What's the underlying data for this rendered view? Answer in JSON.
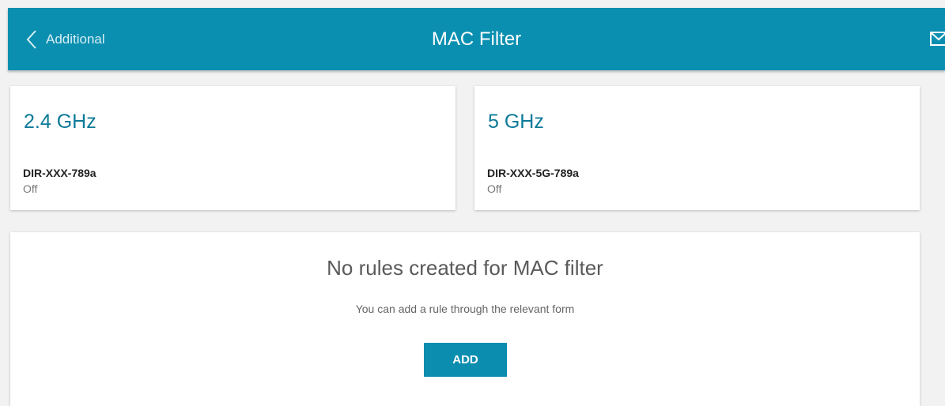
{
  "header": {
    "back_label": "Additional",
    "title": "MAC Filter",
    "back_icon": "chevron-left-icon",
    "mail_icon": "mail-icon",
    "background_color": "#0a8fb0"
  },
  "bands": [
    {
      "name": "2.4 GHz",
      "ssid": "DIR-XXX-789a",
      "status": "Off"
    },
    {
      "name": "5 GHz",
      "ssid": "DIR-XXX-5G-789a",
      "status": "Off"
    }
  ],
  "rules_panel": {
    "empty_title": "No rules created for MAC filter",
    "hint": "You can add a rule through the relevant form",
    "add_label": "ADD"
  },
  "colors": {
    "accent": "#0b8db0",
    "band_title": "#0b7a98",
    "page_background": "#f2f2f2"
  }
}
